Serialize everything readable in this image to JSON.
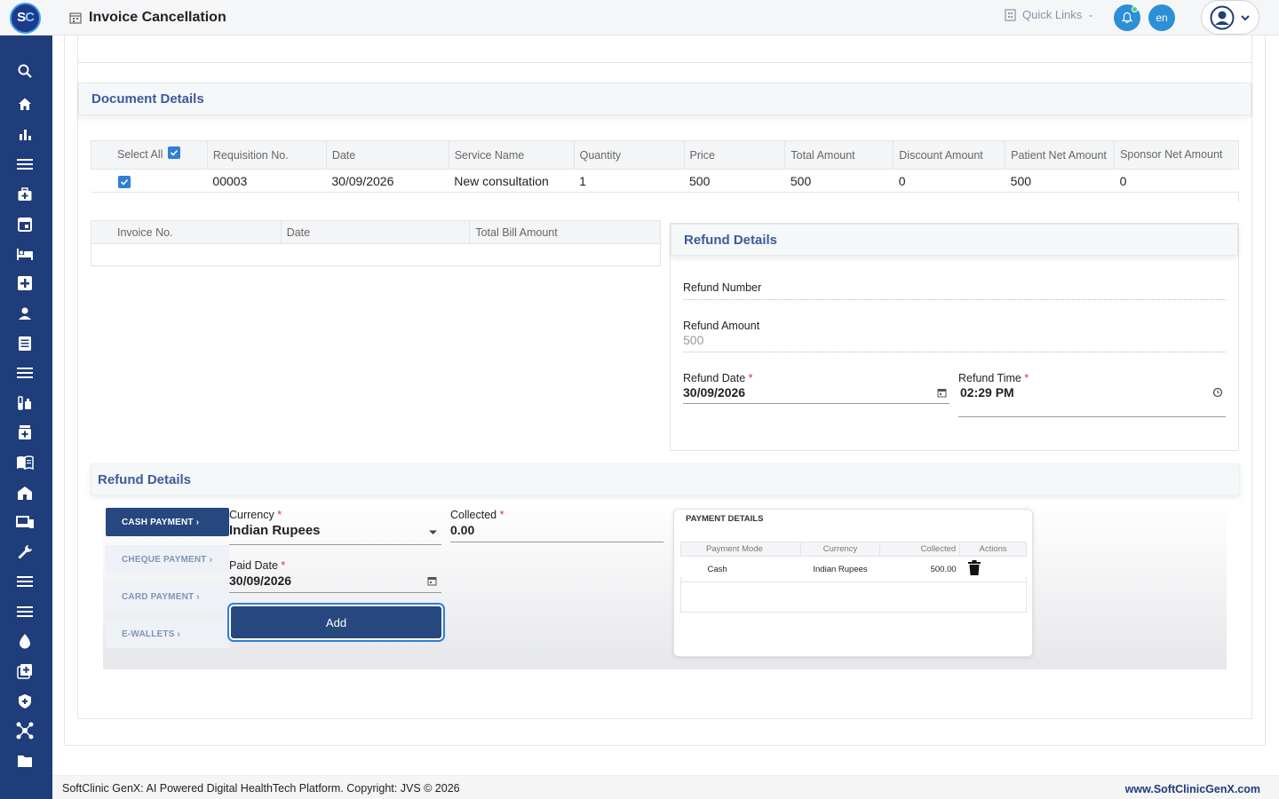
{
  "header": {
    "title": "Invoice Cancellation",
    "logo_text_s": "S",
    "logo_text_c": "C",
    "quick_links": "Quick Links",
    "lang": "en"
  },
  "sidebar": {
    "items": [
      "search-icon",
      "home-icon",
      "bar-chart-icon",
      "menu-icon",
      "medical-bag-icon",
      "calendar-icon",
      "bed-icon",
      "plus-box-icon",
      "user-icon",
      "document-icon",
      "list-icon",
      "lab-icon",
      "pharmacy-icon",
      "book-icon",
      "building-icon",
      "devices-icon",
      "wrench-icon",
      "menu-icon-2",
      "menu-icon-3",
      "drop-icon",
      "add-box-icon",
      "shield-icon",
      "network-icon",
      "folder-icon"
    ]
  },
  "document_details": {
    "title": "Document Details",
    "select_all": "Select All",
    "columns": [
      "Requisition No.",
      "Date",
      "Service Name",
      "Quantity",
      "Price",
      "Total Amount",
      "Discount Amount",
      "Patient Net Amount",
      "Sponsor Net Amount"
    ],
    "rows": [
      {
        "requisition_no": "00003",
        "date": "30/09/2026",
        "service_name": "New consultation",
        "quantity": "1",
        "price": "500",
        "total_amount": "500",
        "discount_amount": "0",
        "patient_net_amount": "500",
        "sponsor_net_amount": "0"
      }
    ]
  },
  "invoice_table": {
    "columns": [
      "Invoice No.",
      "Date",
      "Total Bill Amount"
    ]
  },
  "refund_panel": {
    "title": "Refund Details",
    "refund_number_label": "Refund Number",
    "refund_number_value": "",
    "refund_amount_label": "Refund Amount",
    "refund_amount_value": "500",
    "refund_date_label": "Refund Date",
    "refund_date_value": "30/09/2026",
    "refund_time_label": "Refund Time",
    "refund_time_value": "02:29 PM"
  },
  "refund_section": {
    "title": "Refund Details",
    "tabs": [
      "CASH PAYMENT ›",
      "CHEQUE PAYMENT ›",
      "CARD PAYMENT ›",
      "E-WALLETS ›"
    ],
    "currency_label": "Currency",
    "currency_value": "Indian Rupees",
    "collected_label": "Collected",
    "collected_value": "0.00",
    "paid_date_label": "Paid Date",
    "paid_date_value": "30/09/2026",
    "add_label": "Add"
  },
  "payment_details": {
    "title": "PAYMENT DETAILS",
    "columns": [
      "Payment Mode",
      "Currency",
      "Collected",
      "Actions"
    ],
    "rows": [
      {
        "mode": "Cash",
        "currency": "Indian Rupees",
        "collected": "500.00"
      }
    ]
  },
  "footer": {
    "left": "SoftClinic GenX: AI Powered Digital HealthTech Platform. Copyright: JVS © 2026",
    "right": "www.SoftClinicGenX.com"
  }
}
